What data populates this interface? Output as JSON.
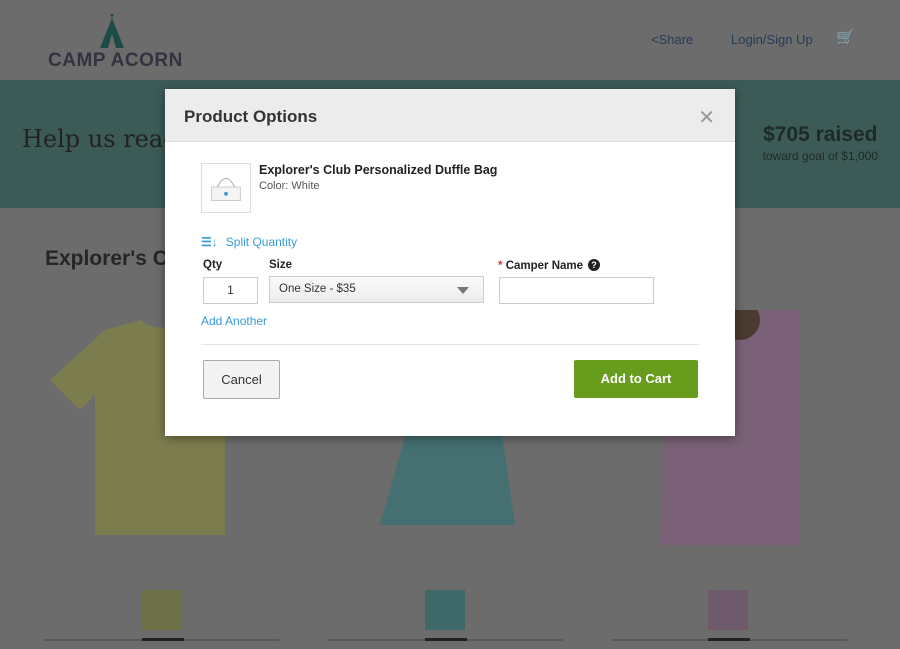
{
  "header": {
    "logo_text": "CAMP ACORN",
    "share": "Share",
    "login": "Login/Sign Up"
  },
  "banner": {
    "text": "Help us reach",
    "raised": "$705 raised",
    "goal": "toward goal of $1,000"
  },
  "section": {
    "title": "Explorer's C"
  },
  "modal": {
    "title": "Product Options",
    "product_name": "Explorer's Club Personalized Duffle Bag",
    "product_color": "Color: White",
    "split_quantity": "Split Quantity",
    "qty_label": "Qty",
    "qty_value": "1",
    "size_label": "Size",
    "size_value": "One Size - $35",
    "required_mark": "*",
    "camper_label": "Camper Name",
    "camper_value": "",
    "add_another": "Add Another",
    "cancel": "Cancel",
    "add_to_cart": "Add to Cart"
  },
  "colors": {
    "accent": "#3a9ad9",
    "cta": "#689c1c"
  }
}
